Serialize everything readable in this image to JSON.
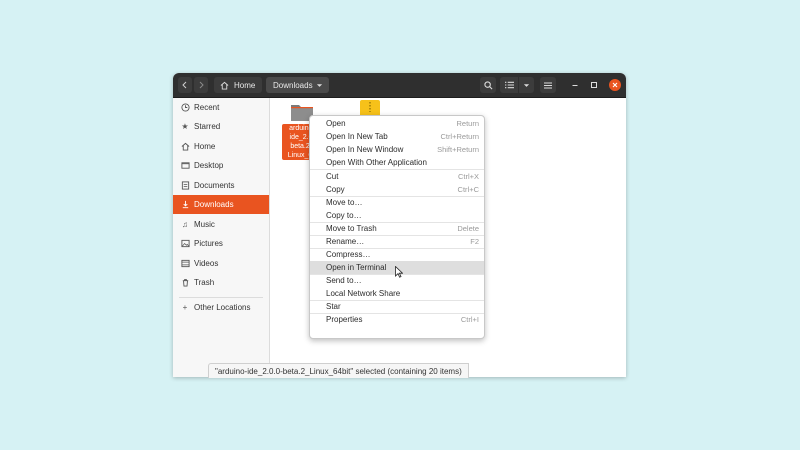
{
  "headerbar": {
    "back_icon": "chevron-left-icon",
    "forward_icon": "chevron-right-icon",
    "breadcrumb": [
      {
        "label": "Home",
        "icon": "home-icon"
      },
      {
        "label": "Downloads"
      }
    ],
    "window_controls": [
      "minimize-icon",
      "maximize-icon",
      "close-icon"
    ],
    "accent": "#e95420"
  },
  "sidebar": {
    "items": [
      {
        "label": "Recent",
        "icon": "clock-icon"
      },
      {
        "label": "Starred",
        "icon": "star-icon"
      },
      {
        "label": "Home",
        "icon": "home-icon"
      },
      {
        "label": "Desktop",
        "icon": "desktop-icon"
      },
      {
        "label": "Documents",
        "icon": "document-icon"
      },
      {
        "label": "Downloads",
        "icon": "download-icon",
        "active": true
      },
      {
        "label": "Music",
        "icon": "music-icon"
      },
      {
        "label": "Pictures",
        "icon": "picture-icon"
      },
      {
        "label": "Videos",
        "icon": "video-icon"
      },
      {
        "label": "Trash",
        "icon": "trash-icon"
      },
      {
        "label": "Other Locations",
        "icon": "plus-icon"
      }
    ]
  },
  "files": [
    {
      "name_lines": [
        "arduino-",
        "ide_2.0.",
        "beta.2_",
        "Linux_64"
      ],
      "selected": true,
      "icon": "folder-icon"
    },
    {
      "icon": "archive-icon"
    }
  ],
  "context_menu": {
    "items": [
      {
        "label": "Open",
        "shortcut": "Return"
      },
      {
        "label": "Open In New Tab",
        "shortcut": "Ctrl+Return"
      },
      {
        "label": "Open In New Window",
        "shortcut": "Shift+Return"
      },
      {
        "label": "Open With Other Application",
        "shortcut": ""
      },
      {
        "label": "Cut",
        "shortcut": "Ctrl+X"
      },
      {
        "label": "Copy",
        "shortcut": "Ctrl+C"
      },
      {
        "label": "Move to…",
        "shortcut": ""
      },
      {
        "label": "Copy to…",
        "shortcut": ""
      },
      {
        "label": "Move to Trash",
        "shortcut": "Delete"
      },
      {
        "label": "Rename…",
        "shortcut": "F2"
      },
      {
        "label": "Compress…",
        "shortcut": ""
      },
      {
        "label": "Open in Terminal",
        "shortcut": "",
        "hover": true
      },
      {
        "label": "Send to…",
        "shortcut": ""
      },
      {
        "label": "Local Network Share",
        "shortcut": ""
      },
      {
        "label": "Star",
        "shortcut": ""
      },
      {
        "label": "Properties",
        "shortcut": "Ctrl+I"
      }
    ]
  },
  "status": {
    "text": "\"arduino-ide_2.0.0-beta.2_Linux_64bit\" selected  (containing 20 items)"
  }
}
